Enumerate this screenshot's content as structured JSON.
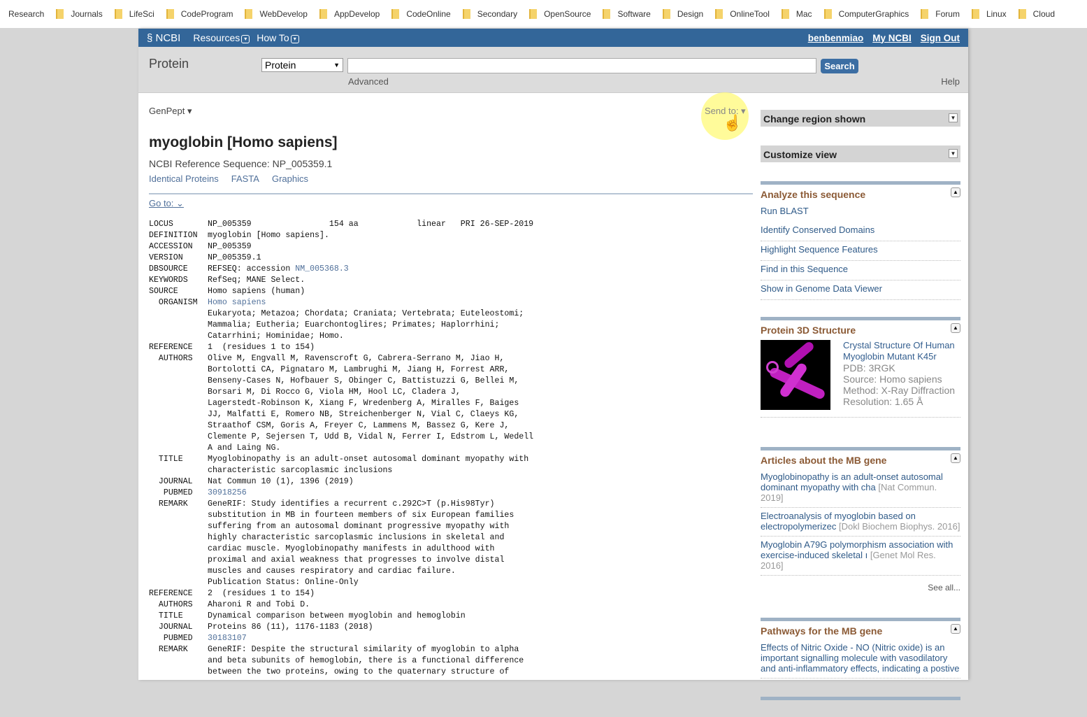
{
  "bookmarks": [
    "Research",
    "Journals",
    "LifeSci",
    "CodeProgram",
    "WebDevelop",
    "AppDevelop",
    "CodeOnline",
    "Secondary",
    "OpenSource",
    "Software",
    "Design",
    "OnlineTool",
    "Mac",
    "ComputerGraphics",
    "Forum",
    "Linux",
    "Cloud"
  ],
  "header": {
    "logo": "NCBI",
    "resources": "Resources",
    "howto": "How To",
    "user": "benbenmiao",
    "myncbi": "My NCBI",
    "signout": "Sign Out"
  },
  "search": {
    "db_title": "Protein",
    "db_selected": "Protein",
    "term": "",
    "button": "Search",
    "advanced": "Advanced",
    "help": "Help"
  },
  "record": {
    "format": "GenPept",
    "send_to": "Send to:",
    "title": "myoglobin [Homo sapiens]",
    "refseq": "NCBI Reference Sequence: NP_005359.1",
    "links": [
      "Identical Proteins",
      "FASTA",
      "Graphics"
    ],
    "goto": "Go to:",
    "lines": [
      [
        "LOCUS",
        "NP_005359                154 aa            linear   PRI 26-SEP-2019"
      ],
      [
        "DEFINITION",
        "myoglobin [Homo sapiens]."
      ],
      [
        "ACCESSION",
        "NP_005359"
      ],
      [
        "VERSION",
        "NP_005359.1"
      ],
      [
        "DBSOURCE",
        "REFSEQ: accession ",
        "NM_005368.3"
      ],
      [
        "KEYWORDS",
        "RefSeq; MANE Select."
      ],
      [
        "SOURCE",
        "Homo sapiens (human)"
      ],
      [
        "  ORGANISM",
        "",
        "Homo sapiens"
      ],
      [
        "",
        "Eukaryota; Metazoa; Chordata; Craniata; Vertebrata; Euteleostomi;"
      ],
      [
        "",
        "Mammalia; Eutheria; Euarchontoglires; Primates; Haplorrhini;"
      ],
      [
        "",
        "Catarrhini; Hominidae; Homo."
      ],
      [
        "REFERENCE",
        "1  (residues 1 to 154)"
      ],
      [
        "  AUTHORS",
        "Olive M, Engvall M, Ravenscroft G, Cabrera-Serrano M, Jiao H,"
      ],
      [
        "",
        "Bortolotti CA, Pignataro M, Lambrughi M, Jiang H, Forrest ARR,"
      ],
      [
        "",
        "Benseny-Cases N, Hofbauer S, Obinger C, Battistuzzi G, Bellei M,"
      ],
      [
        "",
        "Borsari M, Di Rocco G, Viola HM, Hool LC, Cladera J,"
      ],
      [
        "",
        "Lagerstedt-Robinson K, Xiang F, Wredenberg A, Miralles F, Baiges"
      ],
      [
        "",
        "JJ, Malfatti E, Romero NB, Streichenberger N, Vial C, Claeys KG,"
      ],
      [
        "",
        "Straathof CSM, Goris A, Freyer C, Lammens M, Bassez G, Kere J,"
      ],
      [
        "",
        "Clemente P, Sejersen T, Udd B, Vidal N, Ferrer I, Edstrom L, Wedell"
      ],
      [
        "",
        "A and Laing NG."
      ],
      [
        "  TITLE",
        "Myoglobinopathy is an adult-onset autosomal dominant myopathy with"
      ],
      [
        "",
        "characteristic sarcoplasmic inclusions"
      ],
      [
        "  JOURNAL",
        "Nat Commun 10 (1), 1396 (2019)"
      ],
      [
        "   PUBMED",
        "",
        "30918256"
      ],
      [
        "  REMARK",
        "GeneRIF: Study identifies a recurrent c.292C>T (p.His98Tyr)"
      ],
      [
        "",
        "substitution in MB in fourteen members of six European families"
      ],
      [
        "",
        "suffering from an autosomal dominant progressive myopathy with"
      ],
      [
        "",
        "highly characteristic sarcoplasmic inclusions in skeletal and"
      ],
      [
        "",
        "cardiac muscle. Myoglobinopathy manifests in adulthood with"
      ],
      [
        "",
        "proximal and axial weakness that progresses to involve distal"
      ],
      [
        "",
        "muscles and causes respiratory and cardiac failure."
      ],
      [
        "",
        "Publication Status: Online-Only"
      ],
      [
        "REFERENCE",
        "2  (residues 1 to 154)"
      ],
      [
        "  AUTHORS",
        "Aharoni R and Tobi D."
      ],
      [
        "  TITLE",
        "Dynamical comparison between myoglobin and hemoglobin"
      ],
      [
        "  JOURNAL",
        "Proteins 86 (11), 1176-1183 (2018)"
      ],
      [
        "   PUBMED",
        "",
        "30183107"
      ],
      [
        "  REMARK",
        "GeneRIF: Despite the structural similarity of myoglobin to alpha"
      ],
      [
        "",
        "and beta subunits of hemoglobin, there is a functional difference"
      ],
      [
        "",
        "between the two proteins, owing to the quaternary structure of"
      ]
    ]
  },
  "sidebar": {
    "change_region": "Change region shown",
    "customize": "Customize view",
    "analyze": {
      "title": "Analyze this sequence",
      "items": [
        "Run BLAST",
        "Identify Conserved Domains",
        "Highlight Sequence Features",
        "Find in this Sequence",
        "Show in Genome Data Viewer"
      ]
    },
    "structure": {
      "title": "Protein 3D Structure",
      "name": "Crystal Structure Of Human Myoglobin Mutant K45r",
      "pdb": "PDB: 3RGK",
      "source": "Source: Homo sapiens",
      "method": "Method: X-Ray Diffraction",
      "resolution": "Resolution: 1.65 Å"
    },
    "articles": {
      "title": "Articles about the MB gene",
      "items": [
        {
          "text": "Myoglobinopathy is an adult-onset autosomal dominant myopathy with cha",
          "src": "[Nat Commun. 2019]"
        },
        {
          "text": "Electroanalysis of myoglobin based on electropolymerizec",
          "src": "[Dokl Biochem Biophys. 2016]"
        },
        {
          "text": "Myoglobin A79G polymorphism association with exercise-induced skeletal ı",
          "src": "[Genet Mol Res. 2016]"
        }
      ],
      "see_all": "See all..."
    },
    "pathways": {
      "title": "Pathways for the MB gene",
      "items": [
        "Effects of Nitric Oxide - NO (Nitric oxide) is an important signalling molecule with vasodilatory and anti-inflammatory effects, indicating a postive"
      ]
    }
  }
}
